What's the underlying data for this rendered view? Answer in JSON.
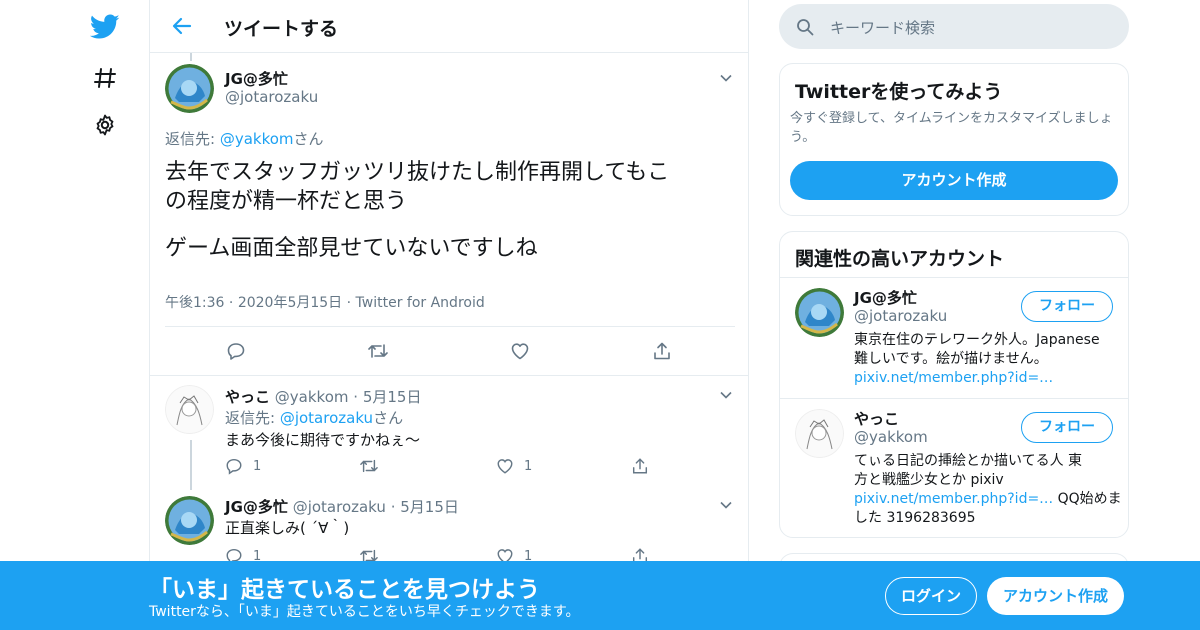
{
  "nav": {
    "logo": "twitter-bird-icon",
    "explore": "hashtag-icon",
    "settings": "gear-icon"
  },
  "header": {
    "title": "ツイートする"
  },
  "main_tweet": {
    "display_name": "JG@多忙",
    "handle": "@jotarozaku",
    "reply_prefix": "返信先: ",
    "reply_to": "@yakkom",
    "reply_suffix": "さん",
    "text_line1": "去年でスタッフガッツリ抜けたし制作再開してもこ",
    "text_line2": "の程度が精一杯だと思う",
    "text_line3": "ゲーム画面全部見せていないですしね",
    "time": "午後1:36",
    "date": "2020年5月15日",
    "source": "Twitter for Android"
  },
  "replies": [
    {
      "display_name": "やっこ",
      "handle": "@yakkom",
      "date": "5月15日",
      "reply_prefix": "返信先: ",
      "reply_to": "@jotarozaku",
      "reply_suffix": "さん",
      "text": "まあ今後に期待ですかねぇ～",
      "reply_count": "1",
      "like_count": "1"
    },
    {
      "display_name": "JG@多忙",
      "handle": "@jotarozaku",
      "date": "5月15日",
      "text": "正直楽しみ( ´∀｀)",
      "reply_count": "1",
      "like_count": "1"
    }
  ],
  "search": {
    "placeholder": "キーワード検索"
  },
  "signup_card": {
    "title": "Twitterを使ってみよう",
    "desc_line1": "今すぐ登録して、タイムラインをカスタマイズしましょ",
    "desc_line2": "う。",
    "button": "アカウント作成"
  },
  "related_card": {
    "title": "関連性の高いアカウント",
    "accounts": [
      {
        "display_name": "JG@多忙",
        "handle": "@jotarozaku",
        "follow": "フォロー",
        "bio_line1": "東京在住のテレワーク外人。Japanese",
        "bio_line2": "難しいです。絵が描けません。",
        "link": "pixiv.net/member.php?id=…",
        "bio_extra": ""
      },
      {
        "display_name": "やっこ",
        "handle": "@yakkom",
        "follow": "フォロー",
        "bio_line1": "てぃる日記の挿絵とか描いてる人 東",
        "bio_line2": "方と戦艦少女とか pixiv",
        "link": "pixiv.net/member.php?id=…",
        "bio_extra": " QQ始めま",
        "bio_line4": "した 3196283695"
      }
    ]
  },
  "banner": {
    "headline": "「いま」起きていることを見つけよう",
    "sub": "Twitterなら、「いま」起きていることをいち早くチェックできます。",
    "login": "ログイン",
    "signup": "アカウント作成"
  },
  "colors": {
    "accent": "#1da1f2",
    "muted": "#657786",
    "border": "#e6ecf0"
  }
}
